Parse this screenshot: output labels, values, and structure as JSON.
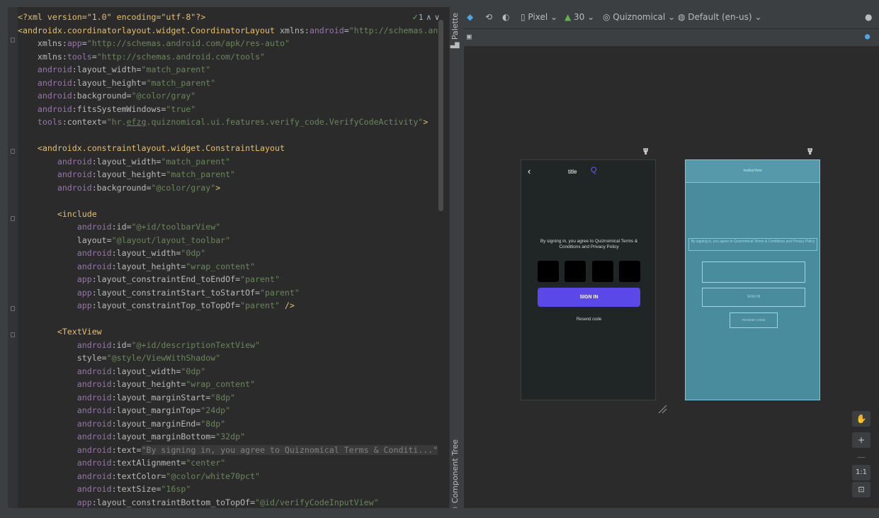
{
  "editor": {
    "inspection_count": "1",
    "lines": [
      {
        "segs": [
          [
            "pi",
            "<?xml version=\"1.0\" encoding=\"utf-8\"?>"
          ]
        ]
      },
      {
        "segs": [
          [
            "t",
            "<androidx.coordinatorlayout.widget.CoordinatorLayout "
          ],
          [
            "a",
            "xmlns:"
          ],
          [
            "ns",
            "android"
          ],
          [
            "a",
            "="
          ],
          [
            "v",
            "\"http://schemas.and"
          ]
        ]
      },
      {
        "segs": [
          [
            "a",
            "    xmlns:"
          ],
          [
            "ns",
            "app"
          ],
          [
            "a",
            "="
          ],
          [
            "v",
            "\"http://schemas.android.com/apk/res-auto\""
          ]
        ]
      },
      {
        "segs": [
          [
            "a",
            "    xmlns:"
          ],
          [
            "ns",
            "tools"
          ],
          [
            "a",
            "="
          ],
          [
            "v",
            "\"http://schemas.android.com/tools\""
          ]
        ]
      },
      {
        "segs": [
          [
            "ns",
            "    android"
          ],
          [
            "a",
            ":layout_width="
          ],
          [
            "v",
            "\"match_parent\""
          ]
        ]
      },
      {
        "segs": [
          [
            "ns",
            "    android"
          ],
          [
            "a",
            ":layout_height="
          ],
          [
            "v",
            "\"match_parent\""
          ]
        ]
      },
      {
        "segs": [
          [
            "ns",
            "    android"
          ],
          [
            "a",
            ":background="
          ],
          [
            "v",
            "\"@color/gray\""
          ]
        ]
      },
      {
        "segs": [
          [
            "ns",
            "    android"
          ],
          [
            "a",
            ":fitsSystemWindows="
          ],
          [
            "v",
            "\"true\""
          ]
        ]
      },
      {
        "segs": [
          [
            "ns",
            "    tools"
          ],
          [
            "a",
            ":context="
          ],
          [
            "v",
            "\"hr."
          ],
          [
            "vu",
            "efzg"
          ],
          [
            "v",
            ".quiznomical.ui.features.verify_code.VerifyCodeActivity\""
          ],
          [
            "t",
            ">"
          ]
        ]
      },
      {
        "segs": []
      },
      {
        "segs": [
          [
            "t",
            "    <androidx.constraintlayout.widget.ConstraintLayout"
          ]
        ]
      },
      {
        "segs": [
          [
            "ns",
            "        android"
          ],
          [
            "a",
            ":layout_width="
          ],
          [
            "v",
            "\"match_parent\""
          ]
        ]
      },
      {
        "segs": [
          [
            "ns",
            "        android"
          ],
          [
            "a",
            ":layout_height="
          ],
          [
            "v",
            "\"match_parent\""
          ]
        ]
      },
      {
        "segs": [
          [
            "ns",
            "        android"
          ],
          [
            "a",
            ":background="
          ],
          [
            "v",
            "\"@color/gray\""
          ],
          [
            "t",
            ">"
          ]
        ]
      },
      {
        "segs": []
      },
      {
        "segs": [
          [
            "t",
            "        <include"
          ]
        ]
      },
      {
        "segs": [
          [
            "ns",
            "            android"
          ],
          [
            "a",
            ":id="
          ],
          [
            "v",
            "\"@+id/toolbarView\""
          ]
        ]
      },
      {
        "segs": [
          [
            "a",
            "            layout="
          ],
          [
            "v",
            "\"@layout/layout_toolbar\""
          ]
        ]
      },
      {
        "segs": [
          [
            "ns",
            "            android"
          ],
          [
            "a",
            ":layout_width="
          ],
          [
            "v",
            "\"0dp\""
          ]
        ]
      },
      {
        "segs": [
          [
            "ns",
            "            android"
          ],
          [
            "a",
            ":layout_height="
          ],
          [
            "v",
            "\"wrap_content\""
          ]
        ]
      },
      {
        "segs": [
          [
            "ns",
            "            app"
          ],
          [
            "a",
            ":layout_constraintEnd_toEndOf="
          ],
          [
            "v",
            "\"parent\""
          ]
        ]
      },
      {
        "segs": [
          [
            "ns",
            "            app"
          ],
          [
            "a",
            ":layout_constraintStart_toStartOf="
          ],
          [
            "v",
            "\"parent\""
          ]
        ]
      },
      {
        "segs": [
          [
            "ns",
            "            app"
          ],
          [
            "a",
            ":layout_constraintTop_toTopOf="
          ],
          [
            "v",
            "\"parent\""
          ],
          [
            "t",
            " />"
          ]
        ]
      },
      {
        "segs": []
      },
      {
        "segs": [
          [
            "t",
            "        <TextView"
          ]
        ]
      },
      {
        "segs": [
          [
            "ns",
            "            android"
          ],
          [
            "a",
            ":id="
          ],
          [
            "v",
            "\"@+id/descriptionTextView\""
          ]
        ]
      },
      {
        "segs": [
          [
            "a",
            "            style="
          ],
          [
            "v",
            "\"@style/ViewWithShadow\""
          ]
        ]
      },
      {
        "segs": [
          [
            "ns",
            "            android"
          ],
          [
            "a",
            ":layout_width="
          ],
          [
            "v",
            "\"0dp\""
          ]
        ]
      },
      {
        "segs": [
          [
            "ns",
            "            android"
          ],
          [
            "a",
            ":layout_height="
          ],
          [
            "v",
            "\"wrap_content\""
          ]
        ]
      },
      {
        "segs": [
          [
            "ns",
            "            android"
          ],
          [
            "a",
            ":layout_marginStart="
          ],
          [
            "v",
            "\"8dp\""
          ]
        ]
      },
      {
        "segs": [
          [
            "ns",
            "            android"
          ],
          [
            "a",
            ":layout_marginTop="
          ],
          [
            "v",
            "\"24dp\""
          ]
        ]
      },
      {
        "segs": [
          [
            "ns",
            "            android"
          ],
          [
            "a",
            ":layout_marginEnd="
          ],
          [
            "v",
            "\"8dp\""
          ]
        ]
      },
      {
        "segs": [
          [
            "ns",
            "            android"
          ],
          [
            "a",
            ":layout_marginBottom="
          ],
          [
            "v",
            "\"32dp\""
          ]
        ]
      },
      {
        "segs": [
          [
            "ns",
            "            android"
          ],
          [
            "a",
            ":text="
          ],
          [
            "f",
            "\"By signing in, you agree to Quiznomical Terms & Conditi...\""
          ]
        ]
      },
      {
        "segs": [
          [
            "ns",
            "            android"
          ],
          [
            "a",
            ":textAlignment="
          ],
          [
            "v",
            "\"center\""
          ]
        ]
      },
      {
        "segs": [
          [
            "ns",
            "            android"
          ],
          [
            "a",
            ":textColor="
          ],
          [
            "v",
            "\"@color/white70pct\""
          ]
        ]
      },
      {
        "segs": [
          [
            "ns",
            "            android"
          ],
          [
            "a",
            ":textSize="
          ],
          [
            "v",
            "\"16sp\""
          ]
        ]
      },
      {
        "segs": [
          [
            "ns",
            "            app"
          ],
          [
            "a",
            ":layout_constraintBottom_toTopOf="
          ],
          [
            "v",
            "\"@id/verifyCodeInputView\""
          ]
        ]
      }
    ]
  },
  "side_tabs": {
    "palette": "Palette",
    "component_tree": "Component Tree"
  },
  "design_toolbar": {
    "device": "Pixel",
    "api_level": "30",
    "theme": "Quiznomical",
    "locale": "Default (en-us)"
  },
  "design_preview": {
    "title": "title",
    "description": "By signing in, you agree to Quiznomical Terms & Conditions and Privacy Policy",
    "sign_in": "SIGN IN",
    "resend": "Resend code"
  },
  "blueprint": {
    "toolbar_label": "toolbarView",
    "description": "By signing in, you agree to Quiznomical Terms & Conditions and Privacy Policy",
    "sign_in": "SIGN IN",
    "resend": "RESEND CODE"
  },
  "zoom": {
    "one_to_one": "1:1",
    "plus": "+",
    "minus": "—"
  }
}
